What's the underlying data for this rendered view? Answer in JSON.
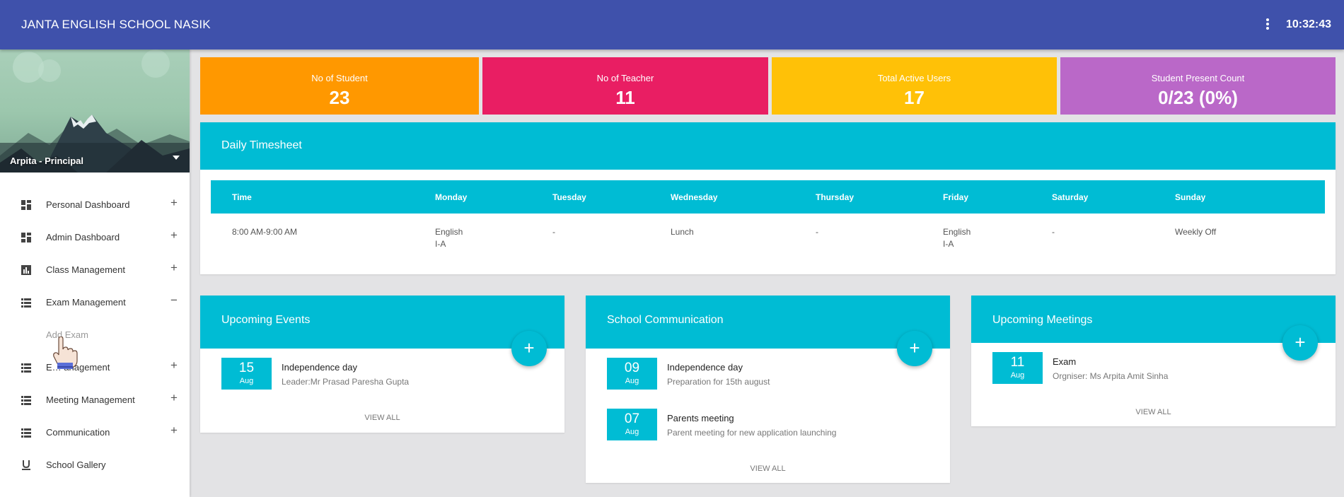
{
  "header": {
    "school_name": "JANTA ENGLISH SCHOOL NASIK",
    "clock": "10:32:43"
  },
  "profile": {
    "user": "Arpita - Principal"
  },
  "sidebar": {
    "items": [
      {
        "label": "Personal Dashboard",
        "toggle": "+"
      },
      {
        "label": "Admin Dashboard",
        "toggle": "+"
      },
      {
        "label": "Class Management",
        "toggle": "+"
      },
      {
        "label": "Exam Management",
        "toggle": "−"
      },
      {
        "label": "E… anagement",
        "toggle": "+"
      },
      {
        "label": "Meeting Management",
        "toggle": "+"
      },
      {
        "label": "Communication",
        "toggle": "+"
      },
      {
        "label": "School Gallery"
      }
    ],
    "sub_items": [
      {
        "label": "Add Exam"
      }
    ]
  },
  "stats": [
    {
      "title": "No of Student",
      "value": "23",
      "color": "#ff9800"
    },
    {
      "title": "No of Teacher",
      "value": "11",
      "color": "#e91e63"
    },
    {
      "title": "Total Active Users",
      "value": "17",
      "color": "#ffc107"
    },
    {
      "title": "Student Present Count",
      "value": "0/23 (0%)",
      "color": "#ba68c8"
    }
  ],
  "timesheet": {
    "title": "Daily Timesheet",
    "columns": [
      "Time",
      "Monday",
      "Tuesday",
      "Wednesday",
      "Thursday",
      "Friday",
      "Saturday",
      "Sunday"
    ],
    "rows": [
      {
        "time": "8:00 AM-9:00 AM",
        "monday": [
          "English",
          "I-A"
        ],
        "tuesday": "-",
        "wednesday": "Lunch",
        "thursday": "-",
        "friday": [
          "English",
          "I-A"
        ],
        "saturday": "-",
        "sunday": "Weekly Off"
      }
    ]
  },
  "panels": {
    "events": {
      "title": "Upcoming Events",
      "items": [
        {
          "day": "15",
          "month": "Aug",
          "title": "Independence day",
          "sub": "Leader:Mr Prasad Paresha Gupta"
        }
      ],
      "view_all": "VIEW ALL"
    },
    "communication": {
      "title": "School Communication",
      "items": [
        {
          "day": "09",
          "month": "Aug",
          "title": "Independence day",
          "sub": "Preparation for 15th august"
        },
        {
          "day": "07",
          "month": "Aug",
          "title": "Parents meeting",
          "sub": "Parent meeting for new application launching"
        }
      ],
      "view_all": "VIEW ALL"
    },
    "meetings": {
      "title": "Upcoming Meetings",
      "items": [
        {
          "day": "11",
          "month": "Aug",
          "title": "Exam",
          "sub": "Orgniser: Ms Arpita Amit Sinha"
        }
      ],
      "view_all": "VIEW ALL"
    }
  },
  "fab_label": "+",
  "colors": {
    "primary": "#3f51ab",
    "accent": "#00bcd4"
  },
  "icons": [
    "more-vert-icon",
    "dashboard-icon",
    "bar-chart-icon",
    "list-icon",
    "underline-icon",
    "caret-down-icon",
    "hand-cursor-icon"
  ]
}
